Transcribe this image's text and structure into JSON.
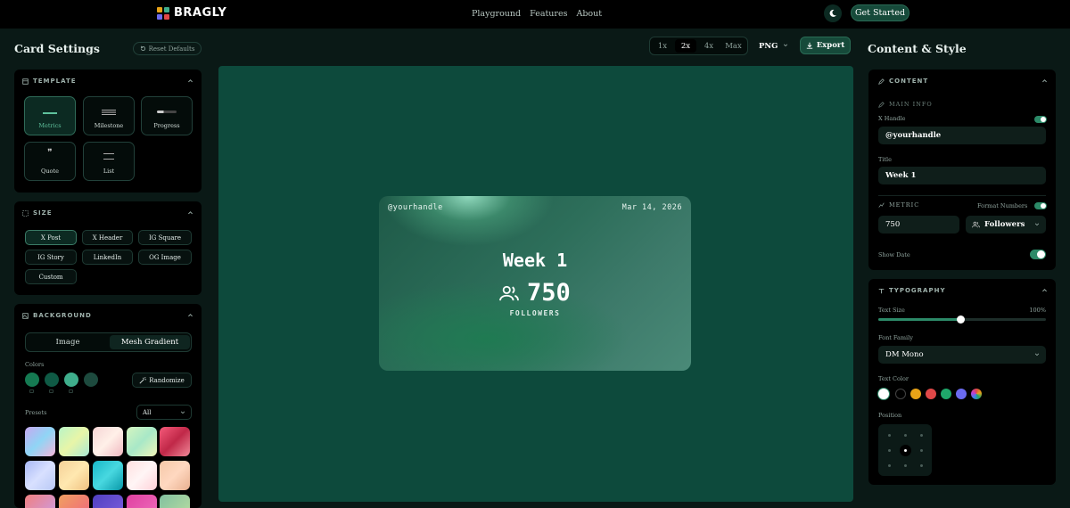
{
  "nav": {
    "brand": "BRAGLY",
    "links": [
      "Playground",
      "Features",
      "About"
    ],
    "get_started": "Get Started"
  },
  "left": {
    "title": "Card Settings",
    "reset": "Reset Defaults",
    "template": {
      "heading": "TEMPLATE",
      "items": [
        "Metrics",
        "Milestone",
        "Progress",
        "Quote",
        "List"
      ],
      "active": "Metrics"
    },
    "size": {
      "heading": "SIZE",
      "items": [
        "X Post",
        "X Header",
        "IG Square",
        "IG Story",
        "LinkedIn",
        "OG Image",
        "Custom"
      ],
      "active": "X Post"
    },
    "background": {
      "heading": "BACKGROUND",
      "tabs": [
        "Image",
        "Mesh Gradient"
      ],
      "active_tab": "Mesh Gradient",
      "colors_label": "Colors",
      "colors": [
        "#157a52",
        "#0f5a45",
        "#3fae8c",
        "#1d4a3e"
      ],
      "randomize": "Randomize",
      "presets_label": "Presets",
      "presets_filter": "All"
    }
  },
  "toolbar": {
    "scales": [
      "1x",
      "2x",
      "4x",
      "Max"
    ],
    "active_scale": "2x",
    "format": "PNG",
    "export": "Export"
  },
  "preview": {
    "handle": "@yourhandle",
    "date": "Mar 14, 2026",
    "title": "Week 1",
    "value": "750",
    "metric_label": "FOLLOWERS"
  },
  "right": {
    "title": "Content & Style",
    "content": {
      "heading": "CONTENT",
      "main_info": "MAIN INFO",
      "x_handle_label": "X Handle",
      "x_handle_value": "@yourhandle",
      "title_label": "Title",
      "title_value": "Week 1",
      "metric_heading": "METRIC",
      "format_numbers": "Format Numbers",
      "metric_value": "750",
      "metric_type": "Followers",
      "show_date": "Show Date"
    },
    "typography": {
      "heading": "TYPOGRAPHY",
      "text_size_label": "Text Size",
      "text_size_value": "100%",
      "text_size_fraction": 0.49,
      "font_family_label": "Font Family",
      "font_family_value": "DM Mono",
      "text_color_label": "Text Color",
      "text_colors": [
        "#ffffff",
        "#000000",
        "#e8a317",
        "#e04848",
        "#1fa86a",
        "#6b6bf0"
      ],
      "position_label": "Position"
    }
  }
}
